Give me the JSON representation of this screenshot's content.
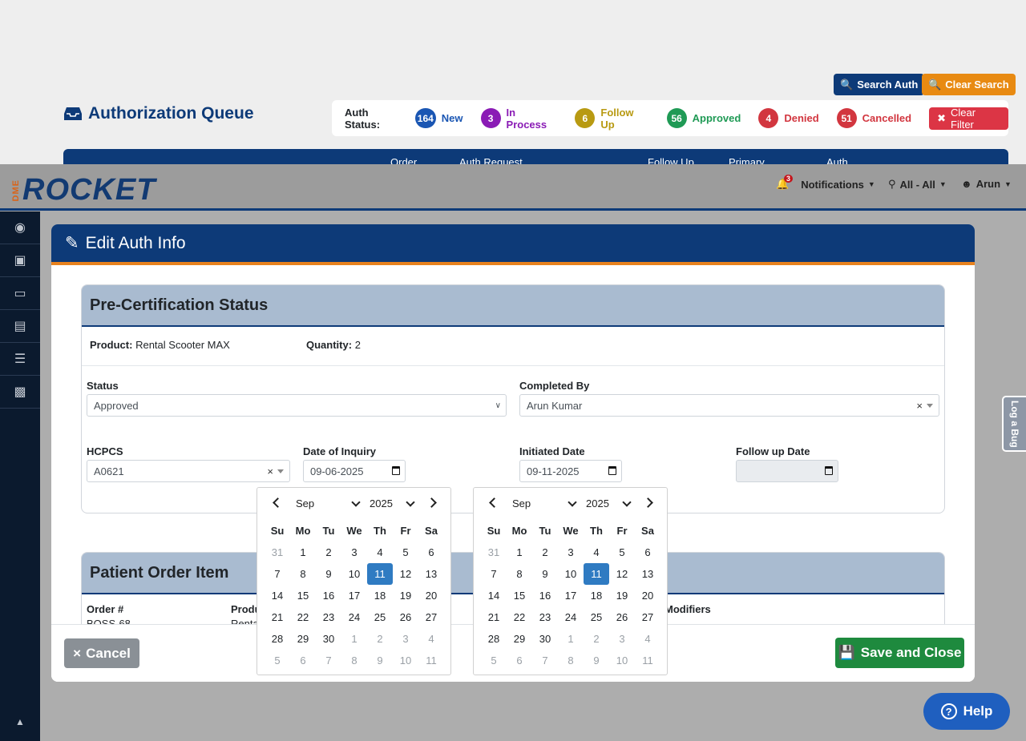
{
  "page": {
    "title": "Authorization Queue",
    "search_auth": "Search Auth",
    "clear_search": "Clear Search",
    "auth_status_label": "Auth Status:",
    "statuses": [
      {
        "count": "164",
        "label": "New",
        "color": "#1a56b3"
      },
      {
        "count": "3",
        "label": "In Process",
        "color": "#8a1bb5"
      },
      {
        "count": "6",
        "label": "Follow Up",
        "color": "#b89a12"
      },
      {
        "count": "56",
        "label": "Approved",
        "color": "#1f9a55"
      },
      {
        "count": "4",
        "label": "Denied",
        "color": "#d2363f"
      },
      {
        "count": "51",
        "label": "Cancelled",
        "color": "#d2363f"
      }
    ],
    "clear_filter": "Clear Filter",
    "table_headers": [
      "Order",
      "Auth Request",
      "Follow Up",
      "Primary",
      "Auth"
    ]
  },
  "topbar": {
    "notif_count": "3",
    "notifications": "Notifications",
    "location": "All - All",
    "user": "Arun",
    "logo_prefix": "DME",
    "logo_text": "ROCKET"
  },
  "modal": {
    "title": "Edit Auth Info",
    "section1_title": "Pre-Certification Status",
    "product_label": "Product:",
    "product_value": "Rental Scooter MAX",
    "quantity_label": "Quantity:",
    "quantity_value": "2",
    "status_label": "Status",
    "status_value": "Approved",
    "completed_by_label": "Completed By",
    "completed_by_value": "Arun Kumar",
    "hcpcs_label": "HCPCS",
    "hcpcs_value": "A0621",
    "date_inquiry_label": "Date of Inquiry",
    "date_inquiry_value": "09-06-2025",
    "initiated_label": "Initiated Date",
    "initiated_value": "09-11-2025",
    "followup_label": "Follow up Date",
    "section2_title": "Patient Order Item",
    "order_label": "Order #",
    "order_value": "BOSS-68",
    "product2_label": "Produ",
    "product2_value": "Renta",
    "modifiers_label": "Modifiers",
    "cancel": "Cancel",
    "save": "Save and Close"
  },
  "calendar": {
    "month": "Sep",
    "year": "2025",
    "weekdays": [
      "Su",
      "Mo",
      "Tu",
      "We",
      "Th",
      "Fr",
      "Sa"
    ],
    "days": [
      "31",
      "1",
      "2",
      "3",
      "4",
      "5",
      "6",
      "7",
      "8",
      "9",
      "10",
      "11",
      "12",
      "13",
      "14",
      "15",
      "16",
      "17",
      "18",
      "19",
      "20",
      "21",
      "22",
      "23",
      "24",
      "25",
      "26",
      "27",
      "28",
      "29",
      "30",
      "1",
      "2",
      "3",
      "4",
      "5",
      "6",
      "7",
      "8",
      "9",
      "10",
      "11"
    ],
    "selected": "11"
  },
  "help": "Help",
  "log_bug": "Log a Bug",
  "colors": {
    "navy": "#0d3a78",
    "accent": "#e8821e",
    "save": "#1e8a3e"
  }
}
